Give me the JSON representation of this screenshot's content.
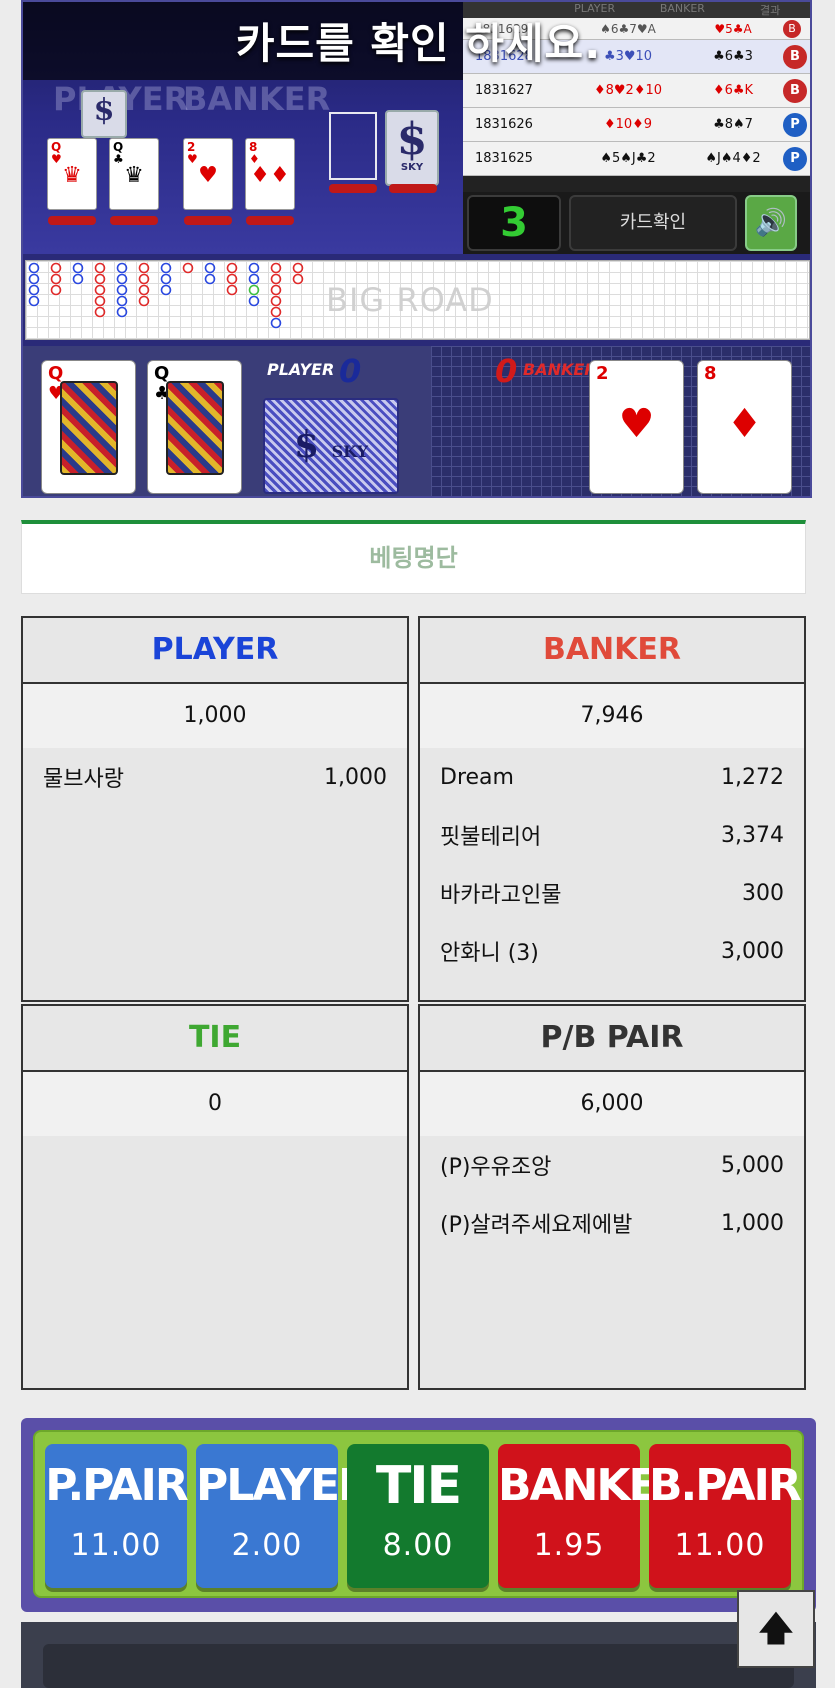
{
  "game": {
    "message": "카드를 확인 하세요.",
    "player_label": "PLAYER",
    "banker_label": "BANKER",
    "table_logo": "SKY",
    "history_header": [
      "",
      "PLAYER",
      "BANKER",
      "결과"
    ],
    "history": [
      {
        "id": "1831629",
        "player": "♠6♣7♥A",
        "banker": "♥5♣A",
        "result": "B"
      },
      {
        "id": "1831628",
        "player": "♣3♥10",
        "banker": "♣6♣3",
        "result": "B"
      },
      {
        "id": "1831627",
        "player": "♦8♥2♦10",
        "banker": "♦6♣K",
        "result": "B"
      },
      {
        "id": "1831626",
        "player": "♦10♦9",
        "banker": "♣8♠7",
        "result": "P"
      },
      {
        "id": "1831625",
        "player": "♠5♠J♣2",
        "banker": "♠J♠4♦2",
        "result": "P"
      }
    ],
    "countdown": "3",
    "card_check_button": "카드확인",
    "speaker_icon": "speaker-icon",
    "big_road_label": "BIG ROAD",
    "player_score_label": "PLAYER",
    "player_score": "0",
    "banker_score_label": "BANKER",
    "banker_score": "0",
    "player_cards": [
      {
        "rank": "Q",
        "suit": "♥"
      },
      {
        "rank": "Q",
        "suit": "♣"
      }
    ],
    "banker_cards": [
      {
        "rank": "2",
        "suit": "♥"
      },
      {
        "rank": "8",
        "suit": "♦"
      }
    ],
    "card_back_logo": "SKY"
  },
  "bet_list": {
    "tab_label": "베팅명단",
    "player": {
      "title": "PLAYER",
      "total": "1,000",
      "rows": [
        {
          "name": "물브사랑",
          "amount": "1,000"
        }
      ]
    },
    "banker": {
      "title": "BANKER",
      "total": "7,946",
      "rows": [
        {
          "name": "Dream",
          "amount": "1,272"
        },
        {
          "name": "핏불테리어",
          "amount": "3,374"
        },
        {
          "name": "바카라고인물",
          "amount": "300"
        },
        {
          "name": "안화니 (3)",
          "amount": "3,000"
        }
      ]
    },
    "tie": {
      "title": "TIE",
      "total": "0",
      "rows": []
    },
    "pair": {
      "title": "P/B PAIR",
      "total": "6,000",
      "rows": [
        {
          "name": "(P)우유조앙",
          "amount": "5,000"
        },
        {
          "name": "(P)살려주세요제에발",
          "amount": "1,000"
        }
      ]
    }
  },
  "bet_buttons": [
    {
      "label": "P.PAIR",
      "odds": "11.00"
    },
    {
      "label": "PLAYER",
      "odds": "2.00"
    },
    {
      "label": "TIE",
      "odds": "8.00"
    },
    {
      "label": "BANKER",
      "odds": "1.95"
    },
    {
      "label": "B.PAIR",
      "odds": "11.00"
    }
  ],
  "colors": {
    "player": "#1a44d8",
    "banker": "#e04a3a",
    "tie": "#3fa832",
    "accent_green": "#1e8f3a"
  },
  "scroll_top_icon": "arrow-up-icon",
  "scroll_top_glyph": "🡅"
}
